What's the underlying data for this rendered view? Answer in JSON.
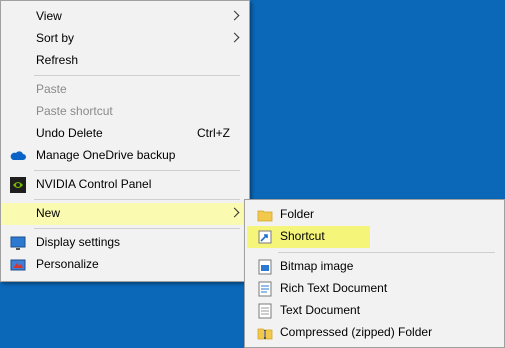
{
  "context_menu": {
    "items": [
      {
        "label": "View"
      },
      {
        "label": "Sort by"
      },
      {
        "label": "Refresh"
      },
      {
        "label": "Paste"
      },
      {
        "label": "Paste shortcut"
      },
      {
        "label": "Undo Delete",
        "shortcut": "Ctrl+Z"
      },
      {
        "label": "Manage OneDrive backup",
        "icon": "onedrive-cloud-icon"
      },
      {
        "label": "NVIDIA Control Panel",
        "icon": "nvidia-icon"
      },
      {
        "label": "New"
      },
      {
        "label": "Display settings",
        "icon": "display-settings-icon"
      },
      {
        "label": "Personalize",
        "icon": "personalize-icon"
      }
    ]
  },
  "new_submenu": {
    "items": [
      {
        "label": "Folder",
        "icon": "folder-icon"
      },
      {
        "label": "Shortcut",
        "icon": "shortcut-icon"
      },
      {
        "label": "Bitmap image",
        "icon": "bitmap-image-icon"
      },
      {
        "label": "Rich Text Document",
        "icon": "rich-text-document-icon"
      },
      {
        "label": "Text Document",
        "icon": "text-document-icon"
      },
      {
        "label": "Compressed (zipped) Folder",
        "icon": "zip-folder-icon"
      }
    ]
  },
  "colors": {
    "desktop": "#0b67b8",
    "menu_bg": "#f2f2f2",
    "highlight": "#fafab0"
  }
}
